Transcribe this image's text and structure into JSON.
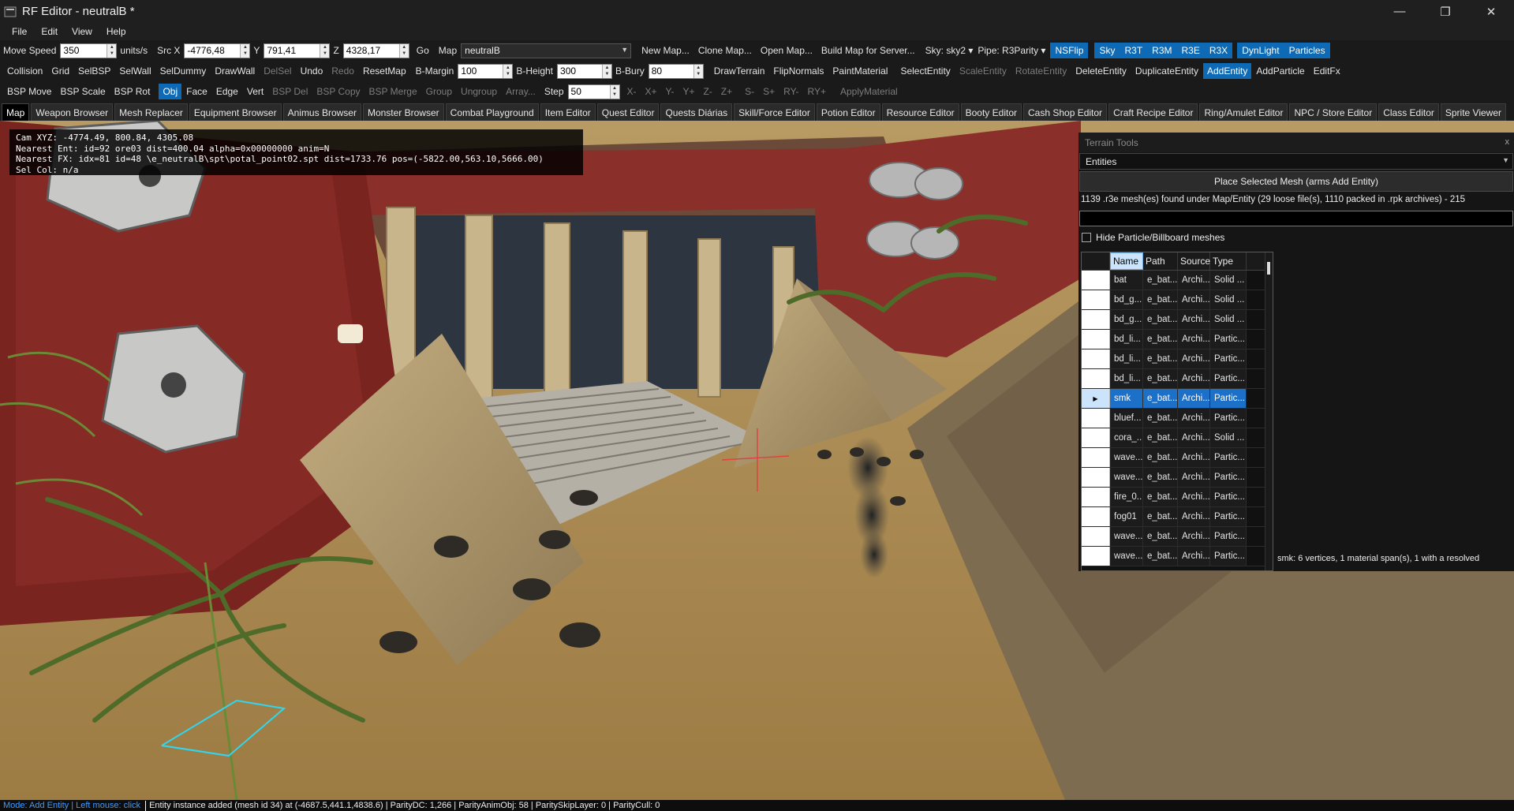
{
  "window": {
    "title": "RF Editor - neutralB *",
    "minimize": "—",
    "maximize": "❐",
    "close": "✕"
  },
  "menu": [
    "File",
    "Edit",
    "View",
    "Help"
  ],
  "toolbar1": {
    "move_speed_label": "Move Speed",
    "move_speed": "350",
    "units": "units/s",
    "src_x_label": "Src X",
    "src_x": "-4776,48",
    "y_label": "Y",
    "y": "791,41",
    "z_label": "Z",
    "z": "4328,17",
    "go": "Go",
    "map_label": "Map",
    "map": "neutralB",
    "new_map": "New Map...",
    "clone_map": "Clone Map...",
    "open_map": "Open Map...",
    "build_map": "Build Map for Server...",
    "sky": "Sky: sky2",
    "pipe": "Pipe: R3Parity",
    "nsflip": "NSFlip",
    "group1": [
      "Sky",
      "R3T",
      "R3M",
      "R3E",
      "R3X"
    ],
    "group2": [
      "DynLight",
      "Particles"
    ]
  },
  "toolbar2": {
    "items_a": [
      {
        "label": "Collision",
        "disabled": false
      },
      {
        "label": "Grid",
        "disabled": false
      },
      {
        "label": "SelBSP",
        "disabled": false
      },
      {
        "label": "SelWall",
        "disabled": false
      },
      {
        "label": "SelDummy",
        "disabled": false
      },
      {
        "label": "DrawWall",
        "disabled": false
      },
      {
        "label": "DelSel",
        "disabled": true
      },
      {
        "label": "Undo",
        "disabled": false
      },
      {
        "label": "Redo",
        "disabled": true
      },
      {
        "label": "ResetMap",
        "disabled": false
      }
    ],
    "b_margin_label": "B-Margin",
    "b_margin": "100",
    "b_height_label": "B-Height",
    "b_height": "300",
    "b_bury_label": "B-Bury",
    "b_bury": "80",
    "items_b": [
      {
        "label": "DrawTerrain",
        "state": "normal"
      },
      {
        "label": "FlipNormals",
        "state": "normal"
      },
      {
        "label": "PaintMaterial",
        "state": "normal"
      },
      {
        "label": "SelectEntity",
        "state": "normal"
      },
      {
        "label": "ScaleEntity",
        "state": "disabled"
      },
      {
        "label": "RotateEntity",
        "state": "disabled"
      },
      {
        "label": "DeleteEntity",
        "state": "normal"
      },
      {
        "label": "DuplicateEntity",
        "state": "normal"
      },
      {
        "label": "AddEntity",
        "state": "active"
      },
      {
        "label": "AddParticle",
        "state": "normal"
      },
      {
        "label": "EditFx",
        "state": "normal"
      }
    ]
  },
  "toolbar3": {
    "items_a": [
      {
        "label": "BSP Move",
        "state": "normal"
      },
      {
        "label": "BSP Scale",
        "state": "normal"
      },
      {
        "label": "BSP Rot",
        "state": "normal"
      },
      {
        "label": "Obj",
        "state": "active"
      },
      {
        "label": "Face",
        "state": "normal"
      },
      {
        "label": "Edge",
        "state": "normal"
      },
      {
        "label": "Vert",
        "state": "normal"
      },
      {
        "label": "BSP Del",
        "state": "disabled"
      },
      {
        "label": "BSP Copy",
        "state": "disabled"
      },
      {
        "label": "BSP Merge",
        "state": "disabled"
      },
      {
        "label": "Group",
        "state": "disabled"
      },
      {
        "label": "Ungroup",
        "state": "disabled"
      },
      {
        "label": "Array...",
        "state": "disabled"
      }
    ],
    "step_label": "Step",
    "step": "50",
    "items_b": [
      "X-",
      "X+",
      "Y-",
      "Y+",
      "Z-",
      "Z+",
      "S-",
      "S+",
      "RY-",
      "RY+",
      "ApplyMaterial"
    ]
  },
  "tabs": [
    {
      "label": "Map",
      "active": true
    },
    {
      "label": "Weapon Browser"
    },
    {
      "label": "Mesh Replacer"
    },
    {
      "label": "Equipment Browser"
    },
    {
      "label": "Animus Browser"
    },
    {
      "label": "Monster Browser"
    },
    {
      "label": "Combat Playground"
    },
    {
      "label": "Item Editor"
    },
    {
      "label": "Quest Editor"
    },
    {
      "label": "Quests Diárias"
    },
    {
      "label": "Skill/Force Editor"
    },
    {
      "label": "Potion Editor"
    },
    {
      "label": "Resource Editor"
    },
    {
      "label": "Booty Editor"
    },
    {
      "label": "Cash Shop Editor"
    },
    {
      "label": "Craft Recipe Editor"
    },
    {
      "label": "Ring/Amulet Editor"
    },
    {
      "label": "NPC / Store Editor"
    },
    {
      "label": "Class Editor"
    },
    {
      "label": "Sprite Viewer"
    }
  ],
  "hud": {
    "line1": "Cam XYZ: -4774.49, 800.84, 4305.08",
    "line2": "Nearest Ent: id=92 ore03 dist=400.04 alpha=0x00000000 anim=N",
    "line3": "Nearest FX: idx=81 id=48 \\e_neutralB\\spt\\potal_point02.spt dist=1733.76 pos=(-5822.00,563.10,5666.00)",
    "line4": "Sel Col: n/a"
  },
  "terrain_panel": {
    "title": "Terrain Tools",
    "close": "x",
    "category": "Entities",
    "place_button": "Place Selected Mesh (arms Add Entity)",
    "mesh_count": "1139 .r3e mesh(es) found under Map/Entity (29 loose file(s), 1110 packed in .rpk archives) - 215",
    "filter_value": "",
    "hide_particles": "Hide Particle/Billboard meshes",
    "columns": [
      "Name",
      "Path",
      "Source",
      "Type"
    ],
    "rows": [
      {
        "name": "bat",
        "path": "e_bat...",
        "source": "Archi...",
        "type": "Solid ..."
      },
      {
        "name": "bd_g...",
        "path": "e_bat...",
        "source": "Archi...",
        "type": "Solid ..."
      },
      {
        "name": "bd_g...",
        "path": "e_bat...",
        "source": "Archi...",
        "type": "Solid ..."
      },
      {
        "name": "bd_li...",
        "path": "e_bat...",
        "source": "Archi...",
        "type": "Partic..."
      },
      {
        "name": "bd_li...",
        "path": "e_bat...",
        "source": "Archi...",
        "type": "Partic..."
      },
      {
        "name": "bd_li...",
        "path": "e_bat...",
        "source": "Archi...",
        "type": "Partic..."
      },
      {
        "name": "smk",
        "path": "e_bat...",
        "source": "Archi...",
        "type": "Partic...",
        "selected": true
      },
      {
        "name": "bluef...",
        "path": "e_bat...",
        "source": "Archi...",
        "type": "Partic..."
      },
      {
        "name": "cora_...",
        "path": "e_bat...",
        "source": "Archi...",
        "type": "Solid ..."
      },
      {
        "name": "wave...",
        "path": "e_bat...",
        "source": "Archi...",
        "type": "Partic..."
      },
      {
        "name": "wave...",
        "path": "e_bat...",
        "source": "Archi...",
        "type": "Partic..."
      },
      {
        "name": "fire_0...",
        "path": "e_bat...",
        "source": "Archi...",
        "type": "Partic..."
      },
      {
        "name": "fog01",
        "path": "e_bat...",
        "source": "Archi...",
        "type": "Partic..."
      },
      {
        "name": "wave...",
        "path": "e_bat...",
        "source": "Archi...",
        "type": "Partic..."
      },
      {
        "name": "wave...",
        "path": "e_bat...",
        "source": "Archi...",
        "type": "Partic..."
      }
    ],
    "preview_info": "smk: 6 vertices, 1 material span(s), 1 with a resolved"
  },
  "status": {
    "mode": "Mode: Add Entity  |  Left mouse: click",
    "message": "Entity instance added (mesh id 34) at (-4687.5,441.1,4838.6) | ParityDC: 1,266 | ParityAnimObj: 58 | ParitySkipLayer: 0 | ParityCull: 0"
  },
  "colors": {
    "accent": "#0e6ab4",
    "selected_row": "#1c70c8",
    "status_mode": "#3f9bff"
  }
}
